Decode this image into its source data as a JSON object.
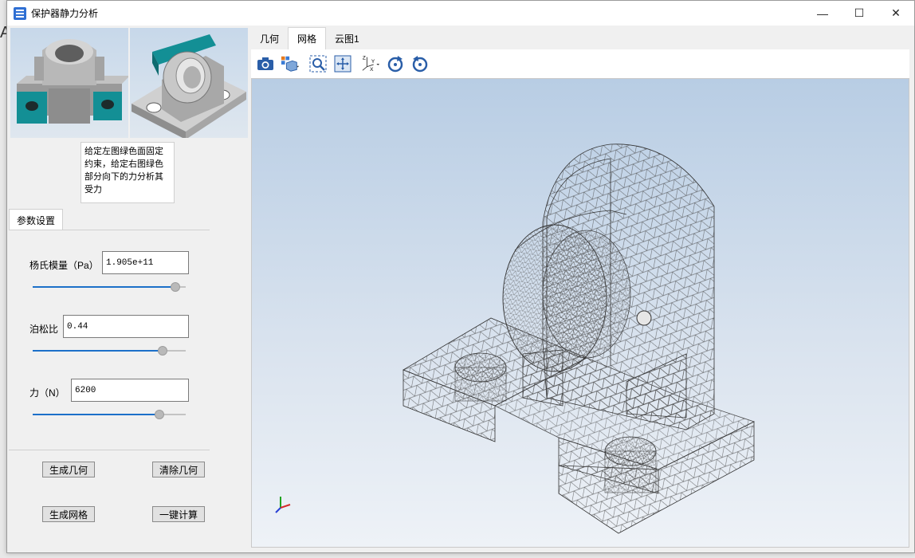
{
  "window": {
    "title": "保护器静力分析",
    "controls": {
      "minimize": "—",
      "maximize": "☐",
      "close": "✕"
    }
  },
  "background": {
    "stub_text": "A"
  },
  "left": {
    "hint_text": "给定左图绿色面固定约束，给定右图绿色部分向下的力分析其受力",
    "params_tab": "参数设置",
    "fields": {
      "youngs": {
        "label": "杨氏模量（Pa）",
        "value": "1.905e+11",
        "slider_fraction": 0.93
      },
      "poisson": {
        "label": "泊松比",
        "value": "0.44",
        "slider_fraction": 0.85
      },
      "force": {
        "label": "力（N）",
        "value": "6200",
        "slider_fraction": 0.83
      }
    },
    "buttons": {
      "gen_geometry": "生成几何",
      "clear_geometry": "清除几何",
      "gen_mesh": "生成网格",
      "one_click": "一键计算"
    }
  },
  "right": {
    "tabs": [
      {
        "label": "几何",
        "active": false
      },
      {
        "label": "网格",
        "active": true
      },
      {
        "label": "云图1",
        "active": false
      }
    ],
    "toolbar_icons": [
      "camera-icon",
      "view-cube-icon",
      "zoom-box-icon",
      "fit-all-icon",
      "axis-view-icon",
      "rotate-cw-icon",
      "rotate-ccw-icon"
    ]
  },
  "colors": {
    "accent": "#1c70c9",
    "teal": "#138f95",
    "mesh": "#3a3a3a"
  }
}
